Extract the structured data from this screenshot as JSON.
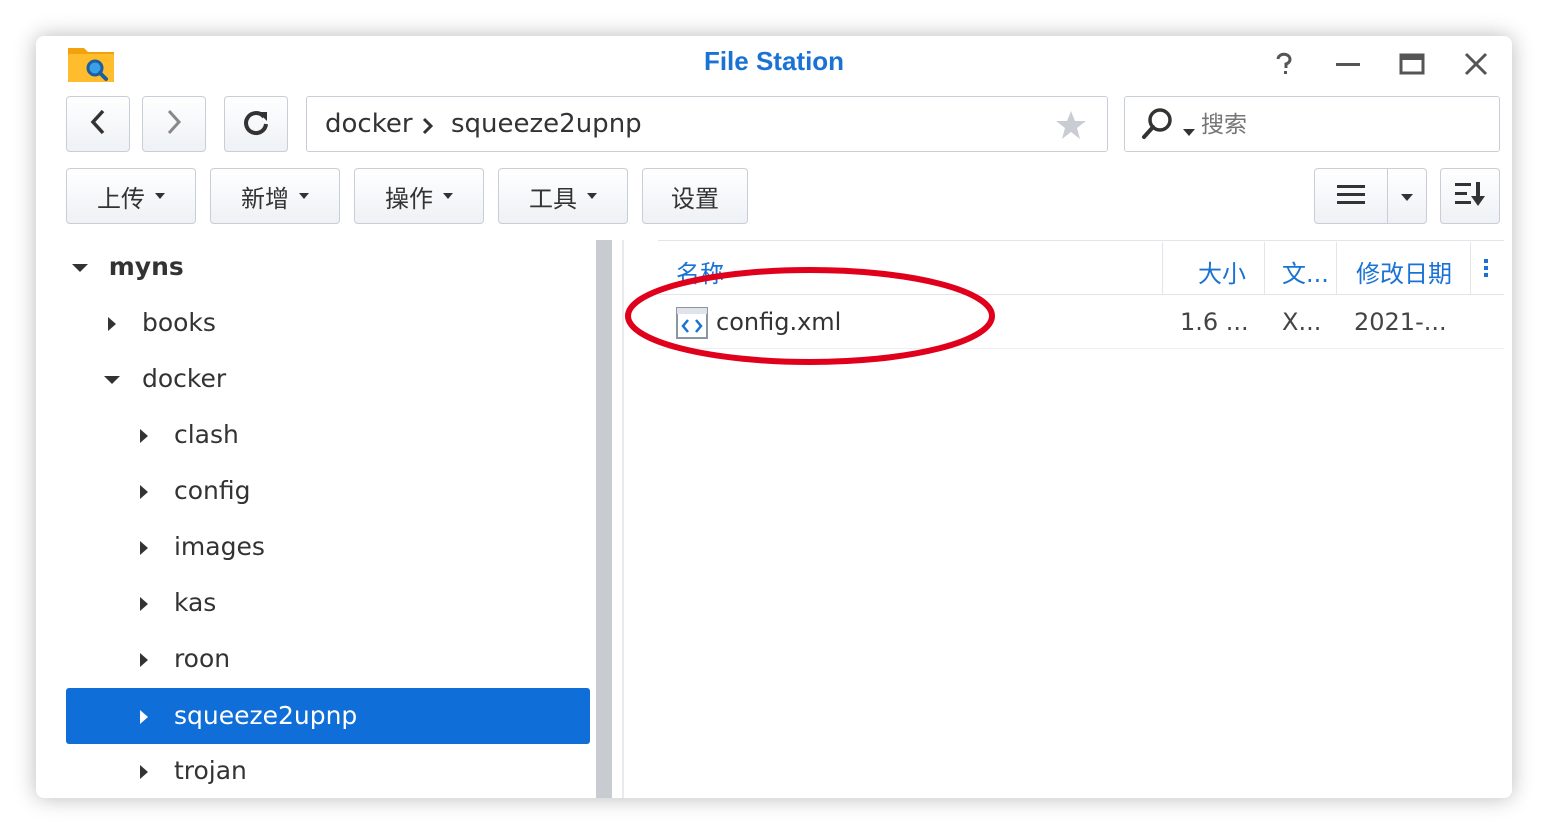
{
  "window": {
    "title": "File Station"
  },
  "titlebar_buttons": [
    "help-icon",
    "minimize-icon",
    "maximize-icon",
    "close-icon"
  ],
  "nav": {
    "back_icon": "chevron-left-icon",
    "forward_icon": "chevron-right-icon",
    "refresh_icon": "refresh-icon"
  },
  "path": {
    "segments": [
      "docker",
      "squeeze2upnp"
    ],
    "favorite_icon": "star-icon"
  },
  "search": {
    "placeholder": "搜索",
    "icon": "search-icon"
  },
  "toolbar": {
    "upload": "上传",
    "create": "新增",
    "action": "操作",
    "tools": "工具",
    "settings": "设置"
  },
  "view_controls": {
    "list_icon": "list-view-icon",
    "dropdown_icon": "chevron-down-icon",
    "sort_icon": "sort-icon"
  },
  "tree": {
    "root": "myns",
    "items": [
      {
        "label": "books",
        "expanded": false
      },
      {
        "label": "docker",
        "expanded": true
      },
      {
        "label": "clash",
        "expanded": false
      },
      {
        "label": "config",
        "expanded": false
      },
      {
        "label": "images",
        "expanded": false
      },
      {
        "label": "kas",
        "expanded": false
      },
      {
        "label": "roon",
        "expanded": false
      },
      {
        "label": "squeeze2upnp",
        "expanded": false,
        "selected": true
      },
      {
        "label": "trojan",
        "expanded": false
      }
    ]
  },
  "file_list": {
    "columns": [
      "名称",
      "大小",
      "文...",
      "修改日期"
    ],
    "rows": [
      {
        "name": "config.xml",
        "size": "1.6 ...",
        "type": "X...",
        "modified": "2021-...",
        "icon": "xml-file-icon"
      }
    ]
  },
  "colors": {
    "accent": "#1a73d4",
    "selection": "#0f6ed8",
    "highlight_ring": "#e0001b"
  }
}
